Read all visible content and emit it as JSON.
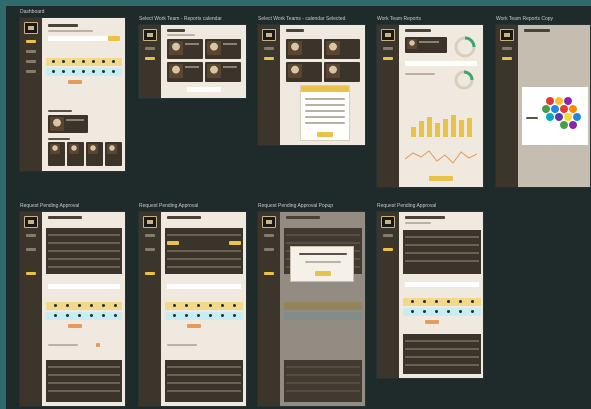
{
  "boards": [
    {
      "id": "dashboard",
      "title": "Dashboard"
    },
    {
      "id": "select-work-team-reports-calendar",
      "title": "Select Work Team - Reports calendar"
    },
    {
      "id": "select-work-team-calendar-selected",
      "title": "Select Work Teams - calendar Selected"
    },
    {
      "id": "work-team-reports",
      "title": "Work Team Reports"
    },
    {
      "id": "work-team-reports-copy",
      "title": "Work Team Reports Copy"
    },
    {
      "id": "request-pending-approval-1",
      "title": "Request Pending Approval"
    },
    {
      "id": "request-pending-approval-2",
      "title": "Request Pending Approval"
    },
    {
      "id": "request-pending-approval-popup",
      "title": "Request Pending Approval Popup"
    },
    {
      "id": "request-pending-approval-3",
      "title": "Request Pending Approval"
    }
  ],
  "colors": {
    "canvas": "#1f2a2b",
    "accent_teal": "#2f6a6c",
    "sidebar": "#3b352c",
    "frame_bg": "#efe9e0",
    "highlight_yellow": "#e9c24a",
    "highlight_cyan": "#c7ecf2",
    "button_orange": "#e59c5a"
  },
  "icons": [
    "logo-icon",
    "nav-dashboard-icon",
    "nav-team-icon",
    "nav-reports-icon",
    "nav-settings-icon"
  ]
}
